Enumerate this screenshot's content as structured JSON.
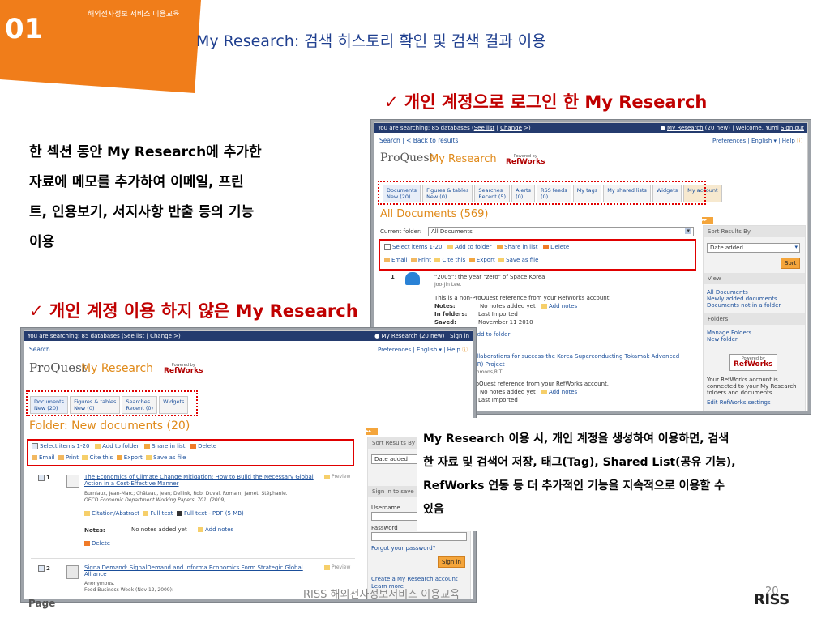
{
  "slide": {
    "number": "01",
    "course_top": "해외전자정보 서비스 이용교육",
    "title": "My Research: 검색 히스토리 확인 및 검색 결과 이용",
    "heading_logged_in": "개인 계정으로 로그인 한 My Research",
    "heading_not_logged_in": "개인 계정 이용 하지 않은 My Research",
    "check_mark": "✓",
    "description_left": [
      "한 섹션 동안 My Research에 추가한",
      "자료에 메모를 추가하여 이메일, 프린",
      "트, 인용보기, 서지사항 반출 등의 기능",
      "이용"
    ],
    "description_right": [
      "My Research 이용 시, 개인 계정을 생성하여 이용하면, 검색",
      "한 자료 및 검색어 저장, 태그(Tag), Shared List(공유 기능),",
      "RefWorks 연동 등 더 추가적인 기능을 지속적으로 이용할 수",
      "있음"
    ],
    "footer_page_label": "Page",
    "footer_center": "RISS 해외전자정보서비스 이용교육",
    "page_number": "20",
    "logo_text": "RISS"
  },
  "shot_logged_in": {
    "top_bar_left": "You are searching: 85 databases (",
    "see_list": "See list",
    "change": "Change",
    "top_bar_right_user": "My Research",
    "top_bar_right_rest": "(20 new) | Welcome, Yumi",
    "sign_out": "Sign out",
    "search_link": "Search",
    "back_link": "< Back to results",
    "preferences": "Preferences | English ▾ | Help",
    "proquest": "ProQuest",
    "my_research": "My Research",
    "powered_by": "Powered by",
    "refworks": "RefWorks",
    "tabs": [
      {
        "label": "Documents",
        "sub": "New (20)"
      },
      {
        "label": "Figures & tables",
        "sub": "New (0)"
      },
      {
        "label": "Searches",
        "sub": "Recent (5)"
      },
      {
        "label": "Alerts",
        "sub": "(0)"
      },
      {
        "label": "RSS feeds",
        "sub": "(0)"
      },
      {
        "label": "My tags",
        "sub": ""
      },
      {
        "label": "My shared lists",
        "sub": ""
      },
      {
        "label": "Widgets",
        "sub": ""
      },
      {
        "label": "My account",
        "sub": ""
      }
    ],
    "heading": "All Documents (569)",
    "current_folder_label": "Current folder:",
    "current_folder_value": "All Documents",
    "select_items": "Select items 1-20",
    "add_to_folder": "Add to folder",
    "share_in_list": "Share in list",
    "delete": "Delete",
    "email": "Email",
    "print": "Print",
    "cite_this": "Cite this",
    "export": "Export",
    "save_as_file": "Save as file",
    "item1_num": "1",
    "item1_title": "\"2005\"; the year \"zero\" of Space Korea",
    "item1_author": "Joo-Jin Lee.",
    "item1_note": "This is a non-ProQuest reference from your RefWorks account.",
    "notes_label": "Notes:",
    "notes_value": "No notes added yet",
    "add_notes": "Add notes",
    "in_folders_label": "In folders:",
    "in_folders_value": "Last Imported",
    "saved_label": "Saved:",
    "saved_value": "November 11 2010",
    "add_to_folder_link": "Add to folder",
    "item2_title_a": "ollaborations for success-the Korea Superconducting Tokamak Advanced",
    "item2_title_b": "AR) Project",
    "item2_author": "immons,R.T...",
    "item2_note": "roQuest reference from your RefWorks account.",
    "sort_results_by": "Sort Results By",
    "sort_value": "Date added",
    "sort_button": "Sort",
    "view": "View",
    "view_links": [
      "All Documents",
      "Newly added documents",
      "Documents not in a folder"
    ],
    "folders": "Folders",
    "folder_links": [
      "Manage Folders",
      "New folder"
    ],
    "refworks_note": "Your RefWorks account is connected to your My Research folders and documents.",
    "edit_refworks": "Edit RefWorks settings"
  },
  "shot_guest": {
    "top_bar_left": "You are searching: 85 databases (",
    "see_list": "See list",
    "change": "Change",
    "top_bar_right_user": "My Research",
    "top_bar_right_rest": "(20 new) |",
    "sign_in": "Sign in",
    "search_link": "Search",
    "preferences": "Preferences | English ▾ | Help",
    "proquest": "ProQuest",
    "my_research": "My Research",
    "powered_by": "Powered by",
    "refworks": "RefWorks",
    "tabs": [
      {
        "label": "Documents",
        "sub": "New (20)"
      },
      {
        "label": "Figures & tables",
        "sub": "New (0)"
      },
      {
        "label": "Searches",
        "sub": "Recent (0)"
      },
      {
        "label": "Widgets",
        "sub": ""
      }
    ],
    "heading": "Folder: New documents (20)",
    "select_items": "Select items 1-20",
    "add_to_folder": "Add to folder",
    "share_in_list": "Share in list",
    "delete": "Delete",
    "email": "Email",
    "print": "Print",
    "cite_this": "Cite this",
    "export": "Export",
    "save_as_file": "Save as file",
    "preview": "Preview",
    "item1_num": "1",
    "item1_title": "The Economics of Climate Change Mitigation: How to Build the Necessary Global Action in a Cost-Effective Manner",
    "item1_authors": "Burniaux, Jean-Marc; Château, Jean; Dellink, Rob; Duval, Romain; Jamet, Stéphanie.",
    "item1_source": "OECD Economic Department Working Papers. 701. (2009).",
    "citation_abstract": "Citation/Abstract",
    "full_text": "Full text",
    "full_text_pdf": "Full text - PDF (5 MB)",
    "notes_label": "Notes:",
    "notes_value": "No notes added yet",
    "add_notes": "Add notes",
    "delete_item": "Delete",
    "item2_num": "2",
    "item2_title": "SignalDemand: SignalDemand and Informa Economics Form Strategic Global Alliance",
    "item2_author": "Anonymous.",
    "item2_source": "Food Business Week (Nov 12, 2009):",
    "sort_results_by": "Sort Results By",
    "sort_value": "Date added",
    "sign_in_to_save": "Sign in to save",
    "username": "Username",
    "password": "Password",
    "forgot_password": "Forgot your password?",
    "sign_in_button": "Sign in",
    "create_account": "Create a My Research account",
    "learn_more": "Learn more"
  }
}
